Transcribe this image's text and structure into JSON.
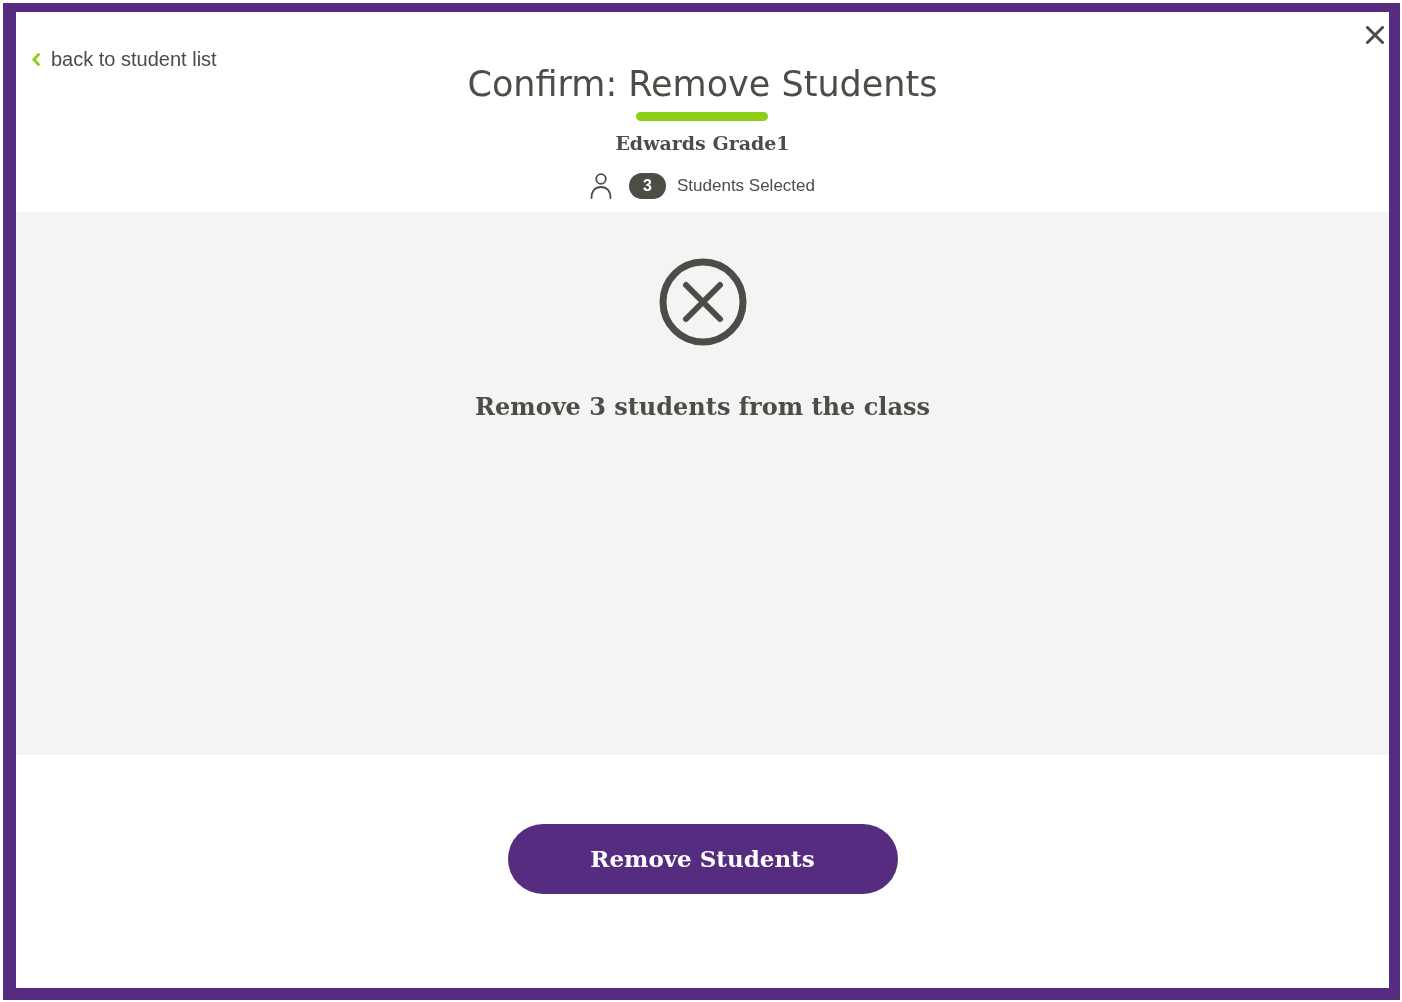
{
  "header": {
    "back_link": {
      "label": "back to student list"
    },
    "title": "Confirm: Remove Students",
    "class_name": "Edwards Grade1",
    "selection": {
      "count": "3",
      "label": "Students Selected"
    }
  },
  "panel": {
    "message": "Remove 3 students from the class"
  },
  "footer": {
    "primary_button": {
      "label": "Remove Students"
    }
  }
}
